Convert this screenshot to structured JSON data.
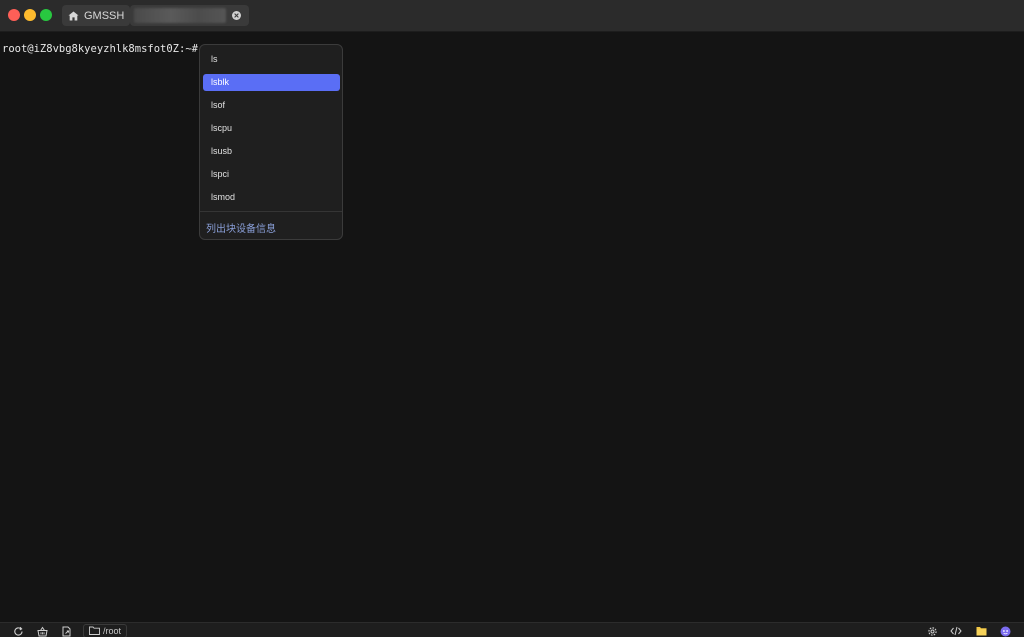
{
  "titlebar": {
    "home_tab_label": "GMSSH"
  },
  "terminal": {
    "prompt": "root@iZ8vbg8kyeyzhlk8msfot0Z:~# ls"
  },
  "autocomplete": {
    "items": [
      "ls",
      "lsblk",
      "lsof",
      "lscpu",
      "lsusb",
      "lspci",
      "lsmod"
    ],
    "selected_index": 1,
    "description": "列出块设备信息",
    "accent_color": "#5a6ef5"
  },
  "statusbar": {
    "path": "/root",
    "left_icons": [
      "refresh-icon",
      "basket-icon",
      "file-export-icon"
    ],
    "right_icons": [
      "gear-icon",
      "code-icon",
      "folder-icon",
      "assistant-icon"
    ]
  }
}
